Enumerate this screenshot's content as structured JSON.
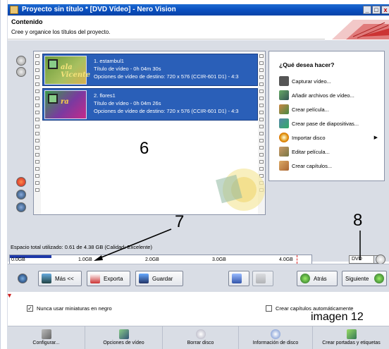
{
  "window": {
    "title": "Proyecto sin título * [DVD Vídeo] - Nero Vision",
    "controls": [
      "_",
      "□",
      "x"
    ]
  },
  "header": {
    "title": "Contenido",
    "subtitle": "Cree y organice los títulos del proyecto."
  },
  "titles": [
    {
      "name": "1. estambul1",
      "duration": "Título de vídeo - 0h 04m 30s",
      "options": "Opciones de vídeo de destino: 720 x 576 (CCIR-601 D1) - 4:3",
      "thumb_caption": "ala Vicente"
    },
    {
      "name": "2. flores1",
      "duration": "Título de vídeo - 0h 04m 26s",
      "options": "Opciones de vídeo de destino: 720 x 576 (CCIR-601 D1) - 4:3",
      "thumb_caption": "ra"
    }
  ],
  "annotations": {
    "n6": "6",
    "n7": "7",
    "n8": "8"
  },
  "what_to_do": {
    "title": "¿Qué desea hacer?",
    "items": [
      {
        "label": "Capturar vídeo...",
        "icon": "camera-icon"
      },
      {
        "label": "Añadir archivos de vídeo...",
        "icon": "add-video-icon"
      },
      {
        "label": "Crear película...",
        "icon": "create-movie-icon"
      },
      {
        "label": "Crear pase de diapositivas...",
        "icon": "slideshow-icon"
      },
      {
        "label": "Importar disco",
        "icon": "import-disc-icon",
        "has_submenu": true
      },
      {
        "label": "Editar película...",
        "icon": "edit-movie-icon"
      },
      {
        "label": "Crear capítulos...",
        "icon": "chapters-icon"
      }
    ]
  },
  "disk": {
    "space_text": "Espacio total utilizado: 0.61 de 4.38 GB (Calidad: Excelente)",
    "ticks": [
      "0.0GB",
      "1.0GB",
      "2.0GB",
      "3.0GB",
      "4.0GB"
    ],
    "used_fraction": 0.139,
    "disc_type": "DVD"
  },
  "toolbar": {
    "more": "Más <<",
    "export": "Exporta",
    "save": "Guardar",
    "back": "Atrás",
    "next": "Siguiente"
  },
  "options": {
    "black_thumbs": "Nunca usar miniaturas en negro",
    "black_thumbs_checked": true,
    "auto_chapters": "Crear capítulos automáticamente",
    "auto_chapters_checked": false,
    "image_caption": "imagen 12"
  },
  "bottom": {
    "configure": "Configurar...",
    "video_options": "Opciones de vídeo",
    "erase_disc": "Borrar disco",
    "disc_info": "Información de disco",
    "covers": "Crear portadas y etiquetas"
  },
  "colors": {
    "titlebar": "#0a4fbf",
    "selected_title": "#2a5fb8",
    "usage_fill": "#1e38a8"
  }
}
